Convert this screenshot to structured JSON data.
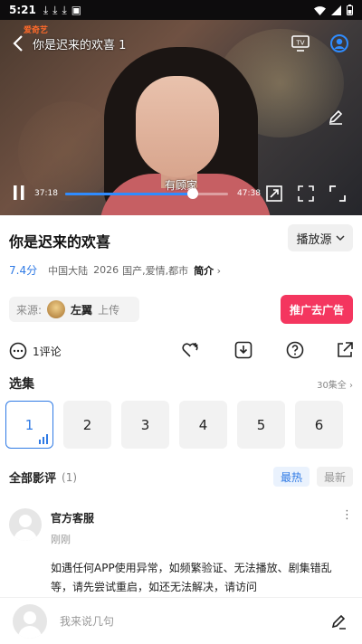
{
  "status_bar": {
    "time": "5:21"
  },
  "player": {
    "title": "你是迟来的欢喜 1",
    "watermark": "爱奇艺",
    "subtitle": "有顾家",
    "current_time": "37:18",
    "total_time": "47:38",
    "progress": 0.783,
    "accent_color": "#2f8cff"
  },
  "show": {
    "title": "你是迟来的欢喜",
    "source_button": "播放源",
    "score": "7.4分",
    "region": "中国大陆",
    "year": "2026",
    "genres": "国产,爱情,都市",
    "intro_label": "简介"
  },
  "uploader": {
    "label": "来源:",
    "name": "左翼",
    "suffix": "上传"
  },
  "ad_button": "推广去广告",
  "actions": {
    "comment_count": "1评论"
  },
  "episodes": {
    "section_title": "选集",
    "more_label": "30集全",
    "items": [
      "1",
      "2",
      "3",
      "4",
      "5",
      "6"
    ],
    "active_index": 0
  },
  "reviews": {
    "title": "全部影评",
    "count": "(1)",
    "sort_hot": "最热",
    "sort_new": "最新"
  },
  "comment": {
    "author": "官方客服",
    "time": "刚刚",
    "text": "如遇任何APP使用异常，如频繁验证、无法播放、剧集错乱等，请先尝试重启，如还无法解决，请访问"
  },
  "bottom_bar": {
    "placeholder": "我来说几句"
  }
}
